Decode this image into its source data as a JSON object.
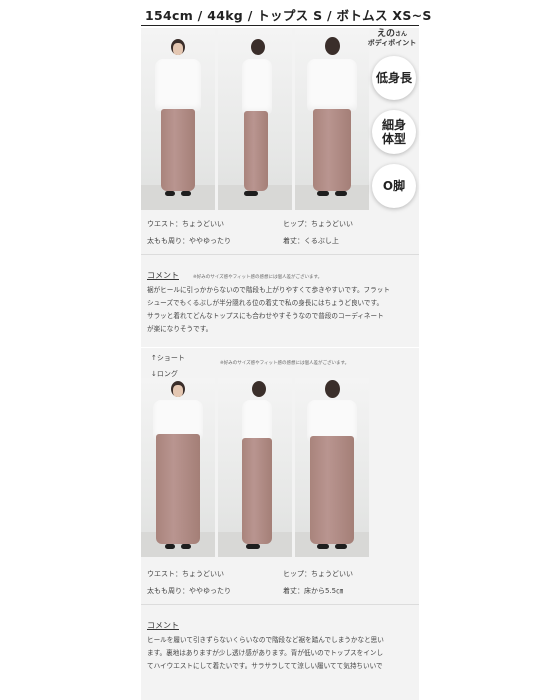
{
  "header": {
    "title": "154cm / 44kg / トップス S / ボトムス XS~S"
  },
  "model_badge": {
    "name": "えの",
    "suffix": "さん",
    "subtitle": "ボディポイント"
  },
  "body_points": [
    "低身長",
    "細身\n体型",
    "O脚"
  ],
  "section1": {
    "specs": {
      "waist": "ウエスト：ちょうどいい",
      "hip": "ヒップ：ちょうどいい",
      "thigh": "太もも周り：ややゆったり",
      "length": "着丈：くるぶし上"
    },
    "comment_title": "コメント",
    "comment_note": "※好みのサイズ感やフィット感の感想には個人差がございます。",
    "comment_lines": [
      "裾がヒールに引っかからないので階段も上がりやすくて歩きやすいです。フラット",
      "シューズでもくるぶしが半分隠れる位の着丈で私の身長にはちょうど良いです。",
      "サラッと着れてどんなトップスにも合わせやすそうなので普段のコーディネート",
      "が楽になりそうです。"
    ]
  },
  "section2": {
    "short_label": "↑ショート",
    "long_label": "↓ロング",
    "note": "※好みのサイズ感やフィット感の感想には個人差がございます。",
    "specs": {
      "waist": "ウエスト：ちょうどいい",
      "hip": "ヒップ：ちょうどいい",
      "thigh": "太もも周り：ややゆったり",
      "length": "着丈：床から5.5㎝"
    },
    "comment_title": "コメント",
    "comment_lines": [
      "ヒールを履いて引きずらないくらいなので階段など裾を踏んでしまうかなと思い",
      "ます。裏地はありますが少し透け感があります。背が低いのでトップスをインし",
      "てハイウエストにして着たいです。サラサラしてて涼しい履いてて気持ちいいで"
    ]
  },
  "colors": {
    "pants": "#b08b83",
    "top": "#fafafa",
    "panel": "#f3f3f3"
  }
}
